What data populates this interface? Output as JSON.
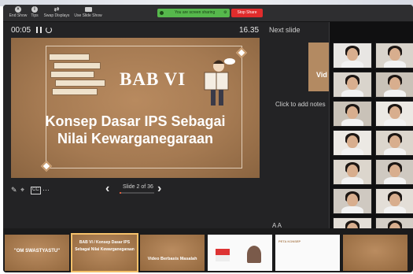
{
  "toolbar": {
    "items": [
      {
        "label": "End Show",
        "icon": "close-icon"
      },
      {
        "label": "Tips",
        "icon": "info-icon"
      },
      {
        "label": "Swap Displays",
        "icon": "swap-icon"
      },
      {
        "label": "Use Slide Show",
        "icon": "display-icon"
      }
    ],
    "sharing_status": "You are screen sharing",
    "stop_share_label": "Stop Share"
  },
  "presenter": {
    "elapsed": "00:05",
    "clock": "16.35",
    "slide_position": "Slide 2 of 36",
    "progress_fraction": 0.056
  },
  "current_slide": {
    "heading": "BAB VI",
    "title_line1": "Konsep Dasar IPS Sebagai",
    "title_line2": "Nilai Kewarganegaraan"
  },
  "next_slide": {
    "label": "Next slide",
    "preview_text": "Vid"
  },
  "notes": {
    "placeholder": "Click to add notes",
    "zoom_controls": "A  A"
  },
  "filmstrip": [
    {
      "title": "\"OM SWASTYASTU\""
    },
    {
      "title": "BAB VI / Konsep Dasar IPS Sebagai Nilai Kewarganegaraan"
    },
    {
      "title": "Video Berbasis Masalah"
    },
    {
      "title": ""
    },
    {
      "title": "PETA KONSEP"
    }
  ],
  "colors": {
    "accent_progress": "#e05a3a",
    "share_green": "#56b84c",
    "stop_red": "#e02c2c",
    "slide_brown": "#a57a52"
  }
}
